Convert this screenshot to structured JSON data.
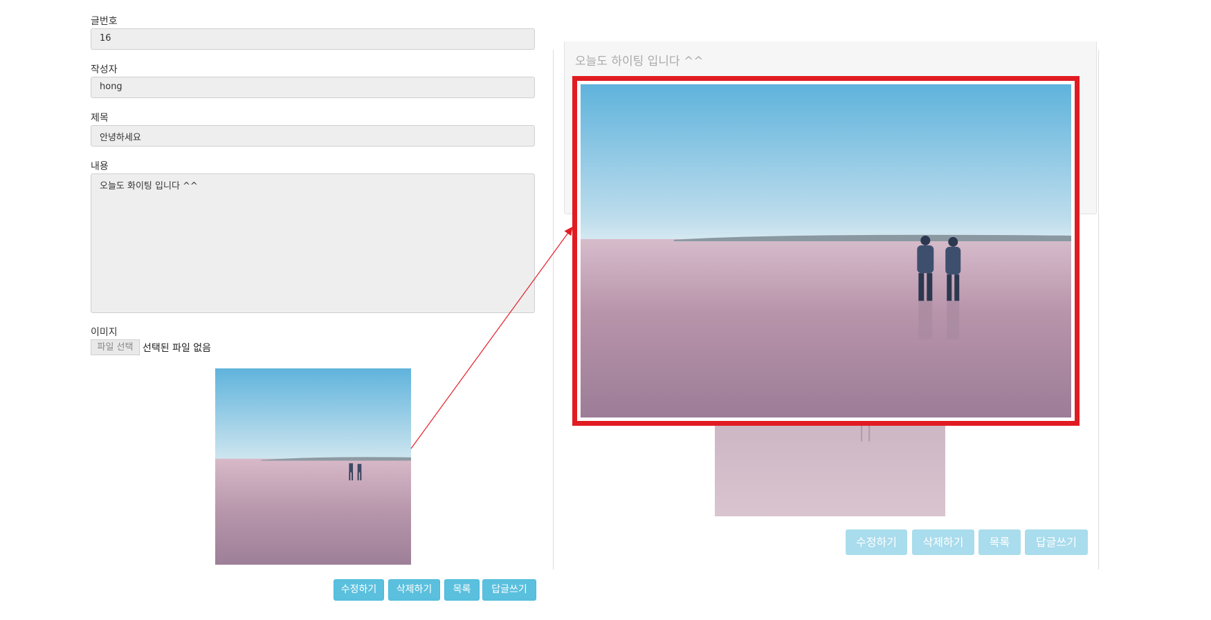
{
  "form": {
    "post_no_label": "글번호",
    "post_no_value": "16",
    "author_label": "작성자",
    "author_value": "hong",
    "title_label": "제목",
    "title_value": "안녕하세요",
    "content_label": "내용",
    "content_value": "오늘도 화이팅 입니다 ^^",
    "image_label": "이미지",
    "file_button": "파일 선택",
    "file_status": "선택된 파일 없음"
  },
  "buttons": {
    "edit": "수정하기",
    "delete": "삭제하기",
    "list": "목록",
    "reply": "답글쓰기"
  },
  "zoom": {
    "content_text": "오늘도 하이팅 입니다 ^^"
  },
  "colors": {
    "button": "#5bc0de",
    "highlight_frame": "#e11b22",
    "arrow": "#e11b22"
  }
}
